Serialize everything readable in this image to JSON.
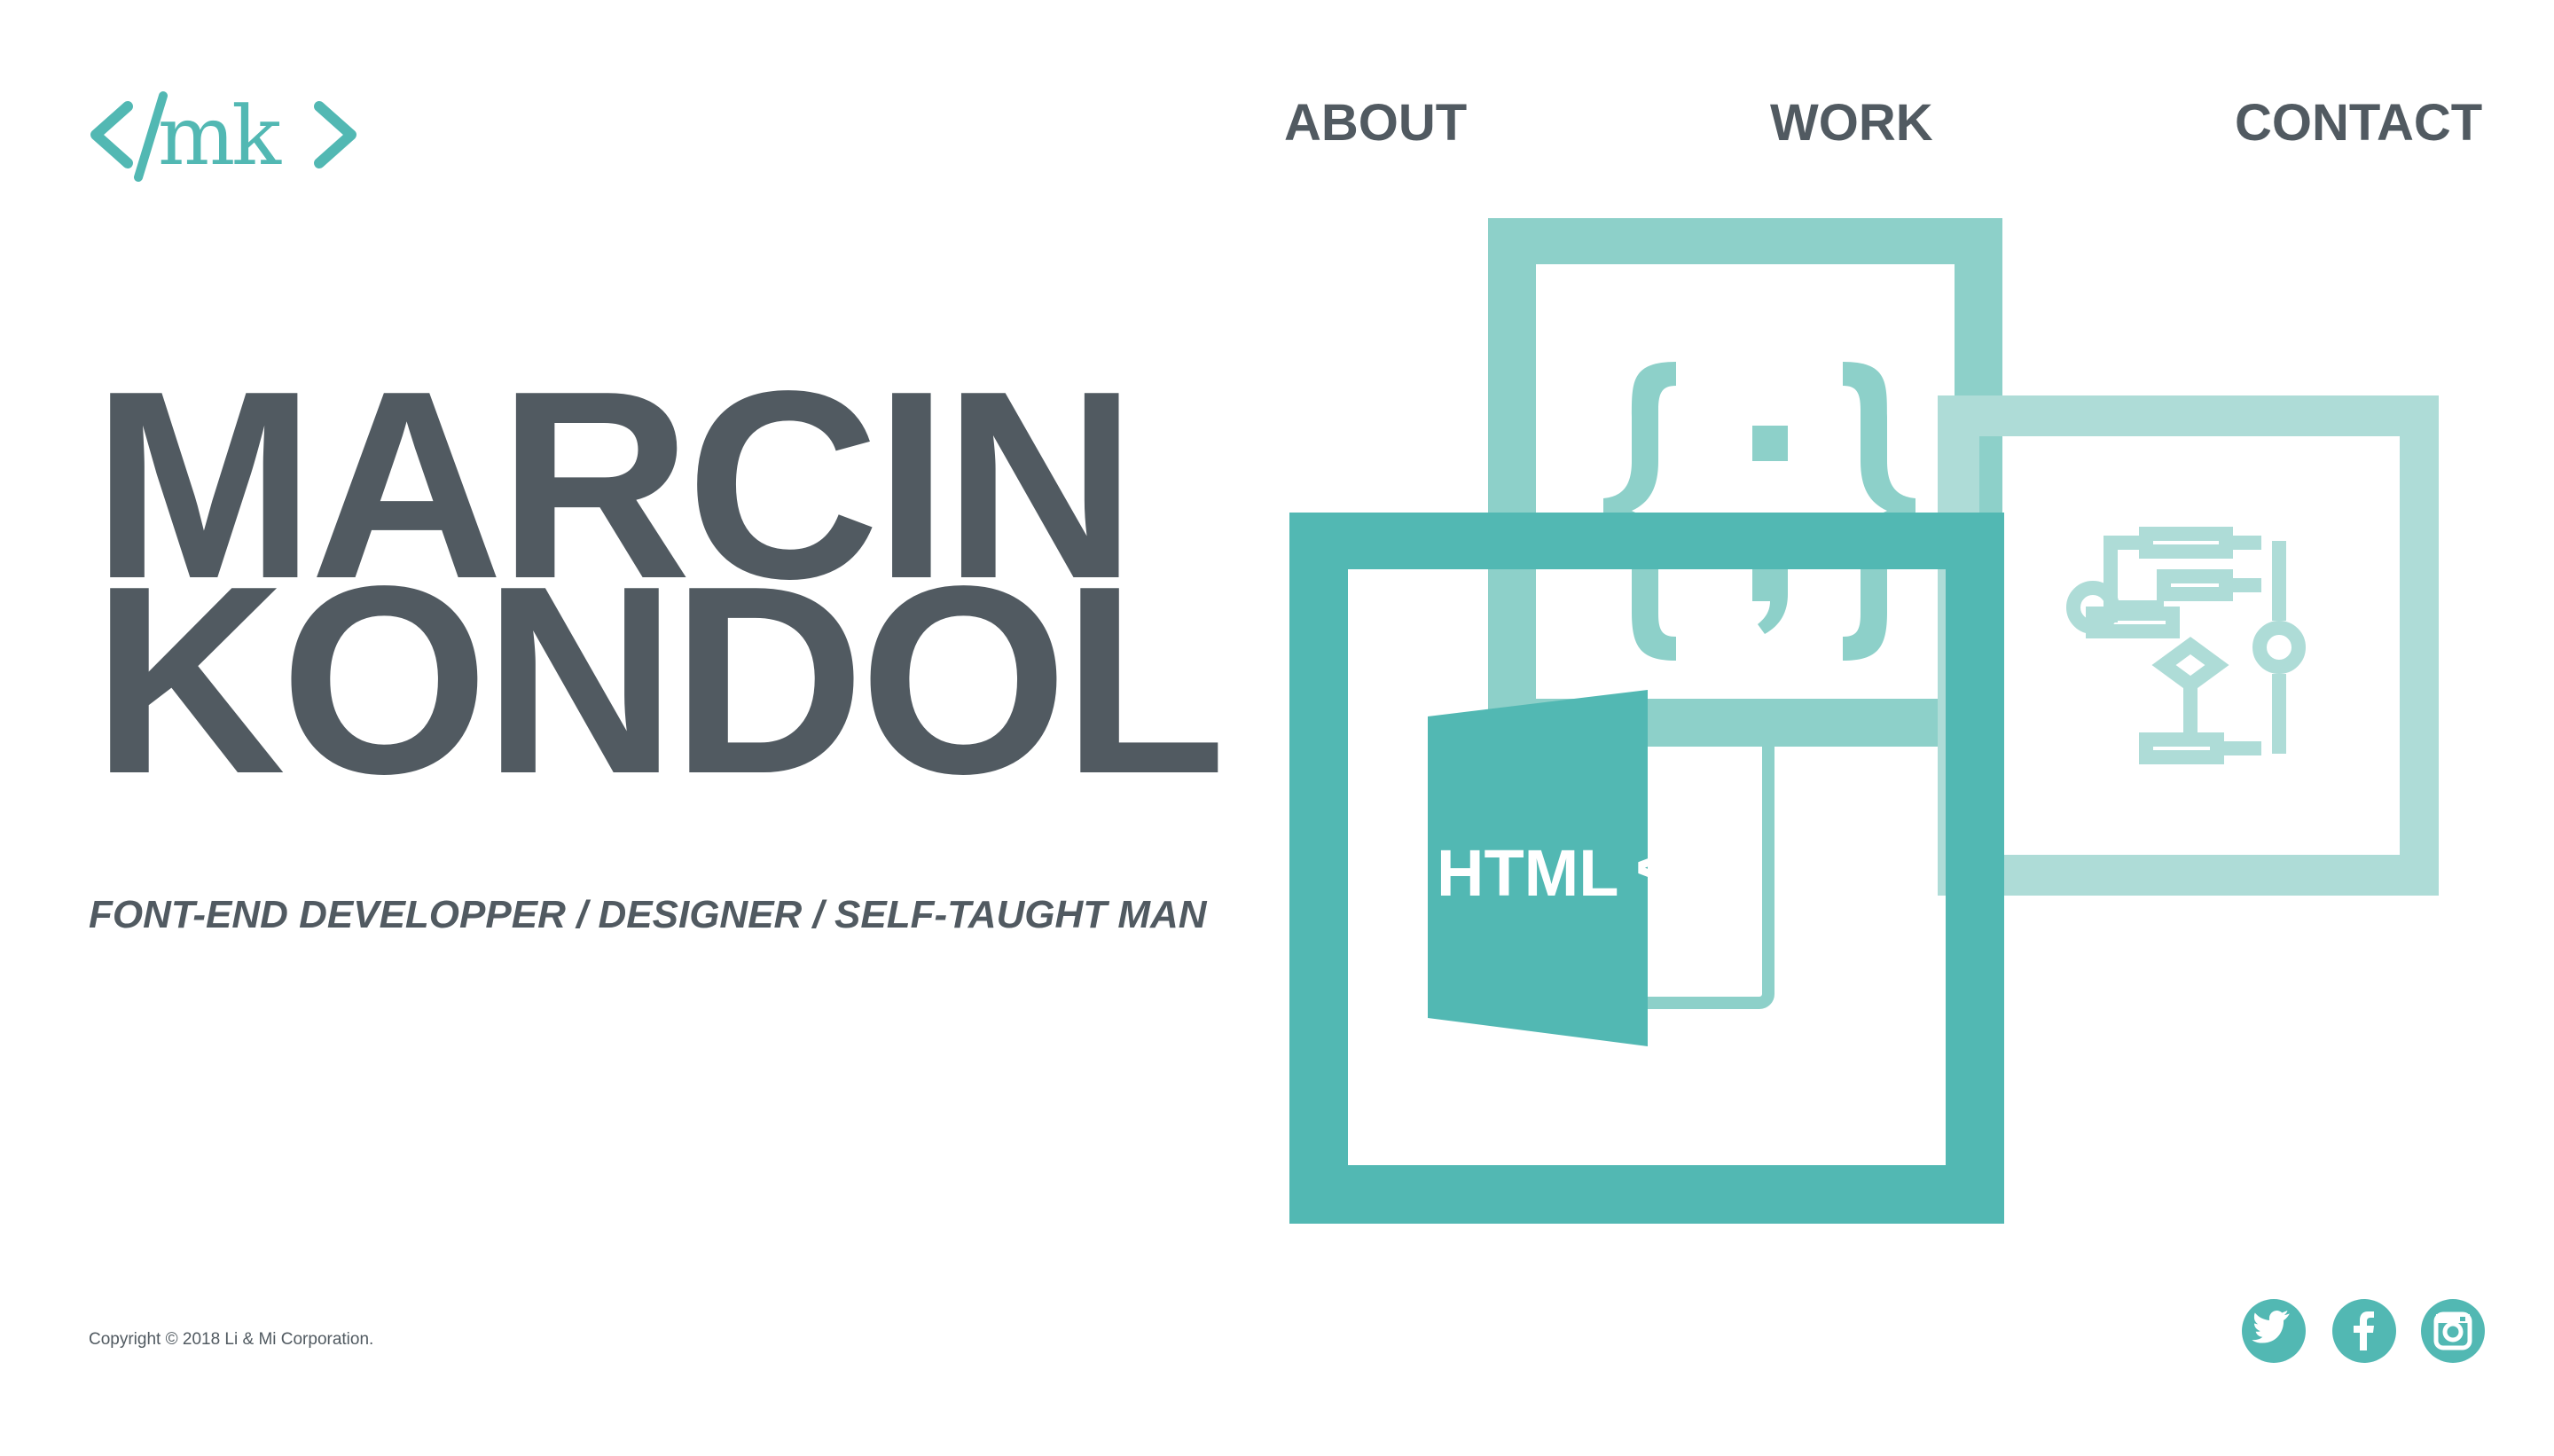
{
  "logo": {
    "text": "mk"
  },
  "nav": {
    "about": "ABOUT",
    "work": "WORK",
    "contact": "CONTACT"
  },
  "hero": {
    "first_name": "MARCIN",
    "last_name": "KONDOL",
    "tagline": "FONT-END DEVELOPPER / DESIGNER / SELF-TAUGHT MAN"
  },
  "illustration": {
    "html_label": "HTML",
    "code_symbol": "</>"
  },
  "footer": {
    "copyright": "Copyright © 2018 Li & Mi Corporation.",
    "social": [
      "twitter-icon",
      "facebook-icon",
      "instagram-icon"
    ]
  },
  "colors": {
    "accent": "#52b8b3",
    "accent_light": "#8dd0c9",
    "accent_lighter": "#aedcd7",
    "text": "#515a61",
    "background": "#ffffff"
  }
}
